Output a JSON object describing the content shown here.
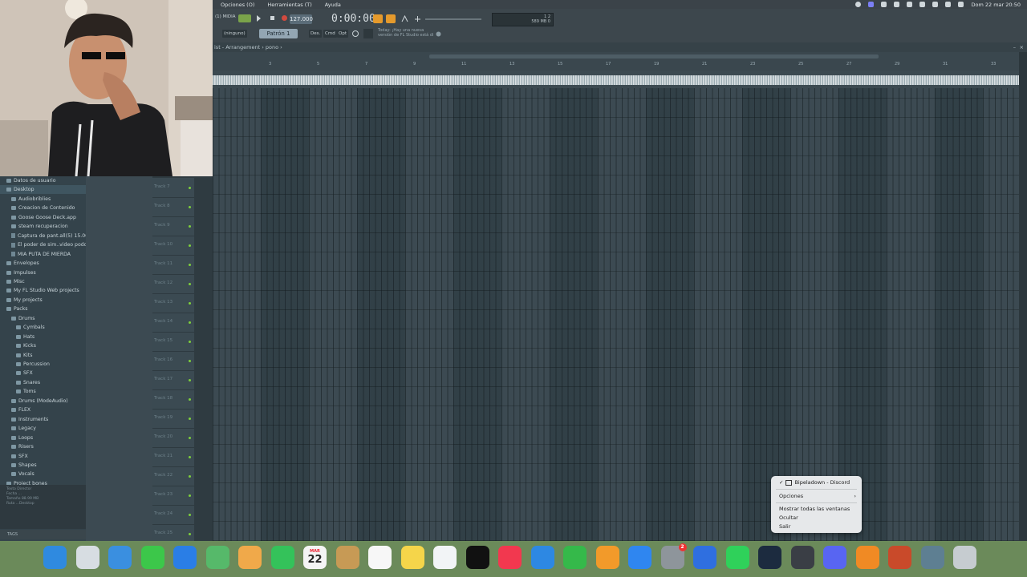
{
  "menubar": {
    "items": [
      "Opciones (O)",
      "Herramientas (T)",
      "Ayuda"
    ],
    "datetime": "Dom 22 mar  20:50"
  },
  "toolbar": {
    "mode_label": "(1) MIDIA",
    "tempo": "127.000",
    "time": "0:00:00",
    "meter_top": "1      2",
    "meter_bottom": "589 MB  0",
    "snap_label": "(ninguno)",
    "pattern_label": "Patrón 1",
    "btn_des": "Des.",
    "btn_cmd": "Cmd",
    "btn_opt": "Opt",
    "hint_line1": "Today: ¡Hay una nueva",
    "hint_line2": "versión de FL Studio está di"
  },
  "playlist": {
    "title": "ist - Arrangement  ›  pono  ›",
    "ruler_labels": [
      "3",
      "5",
      "7",
      "9",
      "11",
      "13",
      "15",
      "17",
      "19",
      "21",
      "23",
      "25",
      "27",
      "29",
      "31",
      "33"
    ]
  },
  "browser": {
    "items": [
      {
        "label": "Datos de usuario",
        "type": "folder",
        "indent": 1
      },
      {
        "label": "Desktop",
        "type": "folder",
        "indent": 1,
        "selected": true
      },
      {
        "label": "Audiobriblies",
        "type": "folder",
        "indent": 2
      },
      {
        "label": "Creacion de Contenido",
        "type": "folder",
        "indent": 2
      },
      {
        "label": "Goose Goose Deck.app",
        "type": "folder",
        "indent": 2
      },
      {
        "label": "steam recuperacion",
        "type": "folder",
        "indent": 2
      },
      {
        "label": "Captura de pant.all(5) 15.06.21",
        "type": "file",
        "indent": 2
      },
      {
        "label": "El poder de sim..video podcast",
        "type": "file",
        "indent": 2
      },
      {
        "label": "MIA PUTA DE MIERDA",
        "type": "file",
        "indent": 2
      },
      {
        "label": "Envelopes",
        "type": "folder",
        "indent": 1
      },
      {
        "label": "Impulses",
        "type": "folder",
        "indent": 1
      },
      {
        "label": "Misc",
        "type": "folder",
        "indent": 1
      },
      {
        "label": "My FL Studio Web projects",
        "type": "folder",
        "indent": 1
      },
      {
        "label": "My projects",
        "type": "folder",
        "indent": 1
      },
      {
        "label": "Packs",
        "type": "folder",
        "indent": 1
      },
      {
        "label": "Drums",
        "type": "folder",
        "indent": 2
      },
      {
        "label": "Cymbals",
        "type": "folder",
        "indent": 3
      },
      {
        "label": "Hats",
        "type": "folder",
        "indent": 3
      },
      {
        "label": "Kicks",
        "type": "folder",
        "indent": 3
      },
      {
        "label": "Kits",
        "type": "folder",
        "indent": 3
      },
      {
        "label": "Percussion",
        "type": "folder",
        "indent": 3
      },
      {
        "label": "SFX",
        "type": "folder",
        "indent": 3
      },
      {
        "label": "Snares",
        "type": "folder",
        "indent": 3
      },
      {
        "label": "Toms",
        "type": "folder",
        "indent": 3
      },
      {
        "label": "Drums (ModeAudio)",
        "type": "folder",
        "indent": 2
      },
      {
        "label": "FLEX",
        "type": "folder",
        "indent": 2
      },
      {
        "label": "Instruments",
        "type": "folder",
        "indent": 2
      },
      {
        "label": "Legacy",
        "type": "folder",
        "indent": 2
      },
      {
        "label": "Loops",
        "type": "folder",
        "indent": 2
      },
      {
        "label": "Risers",
        "type": "folder",
        "indent": 2
      },
      {
        "label": "SFX",
        "type": "folder",
        "indent": 2
      },
      {
        "label": "Shapes",
        "type": "folder",
        "indent": 2
      },
      {
        "label": "Vocals",
        "type": "folder",
        "indent": 2
      },
      {
        "label": "Project bones",
        "type": "folder",
        "indent": 1
      }
    ],
    "info_lines": [
      "Texto   Director",
      "Fecha   ...",
      "Tamaño 88.99 MB",
      "Ruta    ...Desktop"
    ],
    "search_label": "TAGS"
  },
  "tracks": [
    "Track 7",
    "Track 8",
    "Track 9",
    "Track 10",
    "Track 11",
    "Track 12",
    "Track 13",
    "Track 14",
    "Track 15",
    "Track 16",
    "Track 17",
    "Track 18",
    "Track 19",
    "Track 20",
    "Track 21",
    "Track 22",
    "Track 23",
    "Track 24",
    "Track 25"
  ],
  "context_menu": {
    "title": "Bipeladown - Discord",
    "items": [
      "Opciones",
      "Mostrar todas las ventanas",
      "Ocultar",
      "Salir"
    ]
  },
  "dock": {
    "calendar_month": "MAR",
    "calendar_day": "22",
    "settings_badge": "2",
    "apps": [
      {
        "name": "finder",
        "color": "#2f8ae0"
      },
      {
        "name": "launchpad",
        "color": "#d7dde2"
      },
      {
        "name": "safari",
        "color": "#3a8fe0"
      },
      {
        "name": "messages",
        "color": "#3cc74a"
      },
      {
        "name": "mail",
        "color": "#2a7ee6"
      },
      {
        "name": "maps",
        "color": "#56b96a"
      },
      {
        "name": "photos",
        "color": "#f0a94a"
      },
      {
        "name": "facetime",
        "color": "#34c25a"
      },
      {
        "name": "calendar",
        "color": "#f4f4f4"
      },
      {
        "name": "contacts",
        "color": "#c79a55"
      },
      {
        "name": "reminders",
        "color": "#f7f7f7"
      },
      {
        "name": "notes",
        "color": "#f5d54a"
      },
      {
        "name": "freeform",
        "color": "#f2f4f6"
      },
      {
        "name": "apple-tv",
        "color": "#111111"
      },
      {
        "name": "music",
        "color": "#f2384f"
      },
      {
        "name": "keynote",
        "color": "#2d88e3"
      },
      {
        "name": "numbers",
        "color": "#35b94a"
      },
      {
        "name": "pages",
        "color": "#f29a2a"
      },
      {
        "name": "app-store",
        "color": "#2f86f0"
      },
      {
        "name": "system-settings",
        "color": "#8e959b"
      },
      {
        "name": "roblox",
        "color": "#2f6fe0"
      },
      {
        "name": "whatsapp",
        "color": "#2fd15a"
      },
      {
        "name": "steam",
        "color": "#1c2b3f"
      },
      {
        "name": "obs",
        "color": "#3a3e45"
      },
      {
        "name": "discord",
        "color": "#5865f2"
      },
      {
        "name": "fl-studio",
        "color": "#f08a24"
      },
      {
        "name": "screenshot-thumb",
        "color": "#c94a2a"
      },
      {
        "name": "folder-thumb",
        "color": "#5e7f92"
      },
      {
        "name": "trash",
        "color": "#c6ccd0"
      }
    ]
  },
  "colors": {
    "grid": "#34434b",
    "active_dot": "#7ed13b",
    "record": "#d24a3f",
    "accent_orange": "#e59a2c"
  }
}
